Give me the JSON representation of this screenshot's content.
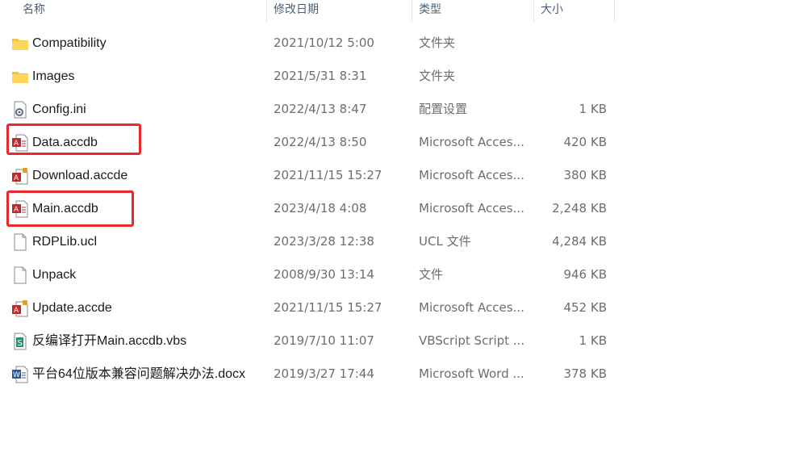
{
  "columns": {
    "name": "名称",
    "modified": "修改日期",
    "type": "类型",
    "size": "大小"
  },
  "files": [
    {
      "icon": "folder-icon",
      "name": "Compatibility",
      "modified": "2021/10/12 5:00",
      "type": "文件夹",
      "size": ""
    },
    {
      "icon": "folder-icon",
      "name": "Images",
      "modified": "2021/5/31 8:31",
      "type": "文件夹",
      "size": ""
    },
    {
      "icon": "config-file-icon",
      "name": "Config.ini",
      "modified": "2022/4/13 8:47",
      "type": "配置设置",
      "size": "1 KB"
    },
    {
      "icon": "access-database-icon",
      "name": "Data.accdb",
      "modified": "2022/4/13 8:50",
      "type": "Microsoft Acces...",
      "size": "420 KB"
    },
    {
      "icon": "access-locked-database-icon",
      "name": "Download.accde",
      "modified": "2021/11/15 15:27",
      "type": "Microsoft Acces...",
      "size": "380 KB"
    },
    {
      "icon": "access-database-icon",
      "name": "Main.accdb",
      "modified": "2023/4/18 4:08",
      "type": "Microsoft Acces...",
      "size": "2,248 KB"
    },
    {
      "icon": "blank-file-icon",
      "name": "RDPLib.ucl",
      "modified": "2023/3/28 12:38",
      "type": "UCL 文件",
      "size": "4,284 KB"
    },
    {
      "icon": "blank-file-icon",
      "name": "Unpack",
      "modified": "2008/9/30 13:14",
      "type": "文件",
      "size": "946 KB"
    },
    {
      "icon": "access-locked-database-icon",
      "name": "Update.accde",
      "modified": "2021/11/15 15:27",
      "type": "Microsoft Acces...",
      "size": "452 KB"
    },
    {
      "icon": "vbscript-file-icon",
      "name": "反编译打开Main.accdb.vbs",
      "modified": "2019/7/10 11:07",
      "type": "VBScript Script ...",
      "size": "1 KB"
    },
    {
      "icon": "word-document-icon",
      "name": "平台64位版本兼容问题解决办法.docx",
      "modified": "2019/3/27 17:44",
      "type": "Microsoft Word ...",
      "size": "378 KB"
    }
  ],
  "highlight_color": "#e8292e",
  "highlighted_rows": [
    3,
    5
  ]
}
